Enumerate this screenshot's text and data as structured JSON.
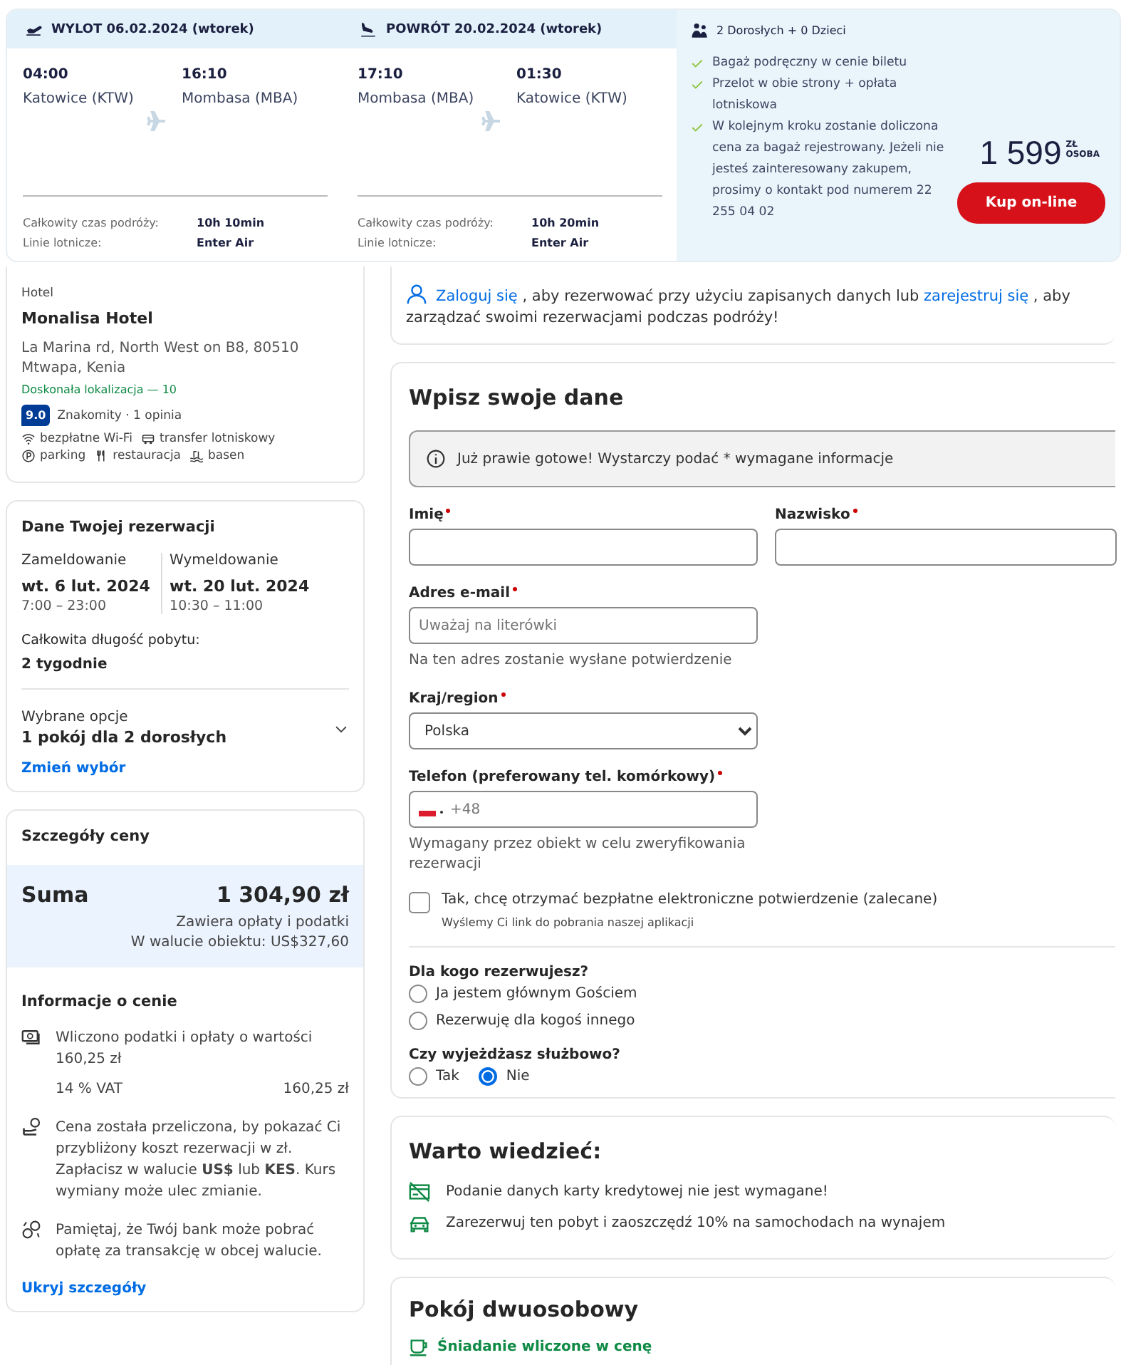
{
  "flight": {
    "legs": [
      {
        "kind": "departure",
        "header": "WYLOT 06.02.2024 (wtorek)",
        "from_time": "04:00",
        "from_place": "Katowice (KTW)",
        "to_time": "16:10",
        "to_place": "Mombasa (MBA)",
        "duration_label": "Całkowity czas podróży:",
        "duration": "10h 10min",
        "airline_label": "Linie lotnicze:",
        "airline": "Enter Air"
      },
      {
        "kind": "return",
        "header": "POWRÓT 20.02.2024 (wtorek)",
        "from_time": "17:10",
        "from_place": "Mombasa (MBA)",
        "to_time": "01:30",
        "to_place": "Katowice (KTW)",
        "duration_label": "Całkowity czas podróży:",
        "duration": "10h 20min",
        "airline_label": "Linie lotnicze:",
        "airline": "Enter Air"
      }
    ],
    "summary": {
      "travellers": "2 Dorosłych + 0 Dzieci",
      "features": [
        "Bagaż podręczny w cenie biletu",
        "Przelot w obie strony + opłata lotniskowa",
        "W kolejnym kroku zostanie doliczona cena za bagaż rejestrowany. Jeżeli nie jesteś zainteresowany zakupem, prosimy o kontakt pod numerem 22 255 04 02"
      ],
      "price": "1 599",
      "currency": "ZŁ",
      "per": "OSOBA",
      "button": "Kup on-line"
    }
  },
  "hotel": {
    "type_label": "Hotel",
    "name": "Monalisa Hotel",
    "address": "La Marina rd, North West on B8, 80510 Mtwapa, Kenia",
    "location_score": "Doskonała lokalizacja — 10",
    "rating": "9.0",
    "rating_text": "Znakomity · 1 opinia",
    "amenities": [
      {
        "kind": "wifi",
        "label": "bezpłatne Wi-Fi"
      },
      {
        "kind": "shuttle",
        "label": "transfer lotniskowy"
      },
      {
        "kind": "parking",
        "label": "parking"
      },
      {
        "kind": "restaurant",
        "label": "restauracja"
      },
      {
        "kind": "pool",
        "label": "basen"
      }
    ]
  },
  "booking": {
    "title": "Dane Twojej rezerwacji",
    "checkin": {
      "label": "Zameldowanie",
      "date": "wt. 6 lut. 2024",
      "time": "7:00 – 23:00"
    },
    "checkout": {
      "label": "Wymeldowanie",
      "date": "wt. 20 lut. 2024",
      "time": "10:30 – 11:00"
    },
    "length_label": "Całkowita długość pobytu:",
    "length": "2 tygodnie",
    "options_label": "Wybrane opcje",
    "options": "1 pokój dla 2 dorosłych",
    "expanded": false,
    "change_link": "Zmień wybór"
  },
  "price": {
    "title": "Szczegóły ceny",
    "total_label": "Suma",
    "total": "1 304,90 zł",
    "notes": [
      "Zawiera opłaty i podatki",
      "W walucie obiektu: US$327,60"
    ],
    "info_title": "Informacje o cenie",
    "items": [
      {
        "kind": "taxes",
        "text": "Wliczono podatki i opłaty o wartości 160,25 zł",
        "sub_label": "14 % VAT",
        "sub_value": "160,25 zł"
      },
      {
        "kind": "currency",
        "text": "Cena została przeliczona, by pokazać Ci przybliżony koszt rezerwacji w zł. Zapłacisz w walucie **US$** lub **KES**. Kurs wymiany może ulec zmianie."
      },
      {
        "kind": "exchange",
        "text": "Pamiętaj, że Twój bank może pobrać opłatę za transakcję w obcej walucie."
      }
    ],
    "hide_link": "Ukryj szczegóły"
  },
  "login": {
    "parts": [
      {
        "kind": "link",
        "text": "Zaloguj się"
      },
      {
        "kind": "text",
        "text": " , aby rezerwować przy użyciu zapisanych danych lub "
      },
      {
        "kind": "link",
        "text": "zarejestruj się"
      },
      {
        "kind": "text",
        "text": " , aby zarządzać swoimi rezerwacjami podczas podróży!"
      }
    ]
  },
  "form": {
    "title": "Wpisz swoje dane",
    "notice": "Już prawie gotowe! Wystarczy podać * wymagane informacje",
    "name_fields": [
      {
        "label": "Imię",
        "required": true
      },
      {
        "label": "Nazwisko",
        "required": true
      }
    ],
    "email": {
      "label": "Adres e-mail",
      "required": true,
      "placeholder": "Uważaj na literówki",
      "hint": "Na ten adres zostanie wysłane potwierdzenie"
    },
    "country": {
      "label": "Kraj/region",
      "required": true,
      "value": "Polska"
    },
    "phone": {
      "label": "Telefon (preferowany tel. komórkowy)",
      "required": true,
      "placeholder": "+48",
      "hint": "Wymagany przez obiekt w celu zweryfikowania rezerwacji"
    },
    "confirmation": {
      "label": "Tak, chcę otrzymać bezpłatne elektroniczne potwierdzenie (zalecane)",
      "sub": "Wyślemy Ci link do pobrania naszej aplikacji",
      "checked": false
    },
    "radio_groups": [
      {
        "question": "Dla kogo rezerwujesz?",
        "inline": false,
        "options": [
          {
            "label": "Ja jestem głównym Gościem",
            "selected": false
          },
          {
            "label": "Rezerwuję dla kogoś innego",
            "selected": false
          }
        ]
      },
      {
        "question": "Czy wyjeżdżasz służbowo?",
        "inline": true,
        "options": [
          {
            "label": "Tak",
            "selected": false
          },
          {
            "label": "Nie",
            "selected": true
          }
        ]
      }
    ]
  },
  "good_to_know": {
    "title": "Warto wiedzieć:",
    "items": [
      {
        "kind": "no-card",
        "text": "Podanie danych karty kredytowej nie jest wymagane!"
      },
      {
        "kind": "car",
        "text": "Zarezerwuj ten pobyt i zaoszczędź 10% na samochodach na wynajem"
      }
    ]
  },
  "room": {
    "title": "Pokój dwuosobowy",
    "perk": "Śniadanie wliczone w cenę"
  }
}
